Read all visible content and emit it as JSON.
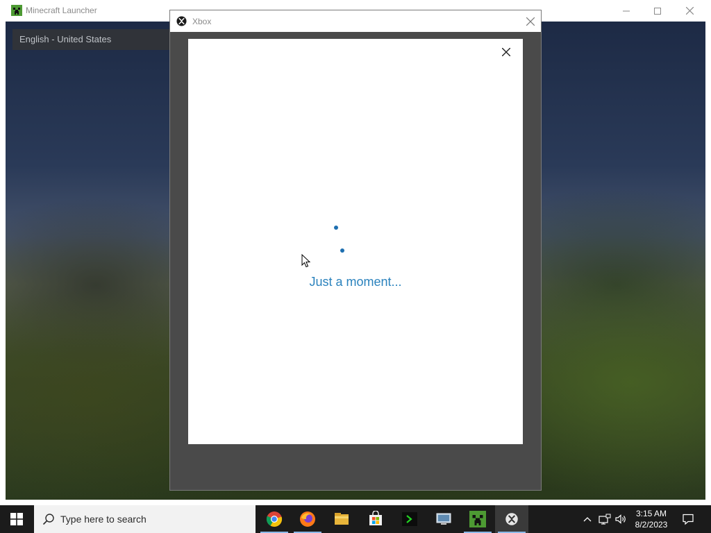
{
  "launcher": {
    "title": "Minecraft Launcher",
    "language": "English - United States"
  },
  "xbox_dialog": {
    "title": "Xbox",
    "loading_text": "Just a moment..."
  },
  "taskbar": {
    "search_placeholder": "Type here to search",
    "apps": [
      "chrome-icon",
      "firefox-icon",
      "file-explorer-icon",
      "microsoft-store-icon",
      "terminal-icon",
      "remote-desktop-icon",
      "minecraft-icon",
      "xbox-icon"
    ],
    "time": "3:15 AM",
    "date": "8/2/2023"
  },
  "colors": {
    "accent_blue": "#2a82bd",
    "spinner": "#1e6fb0",
    "taskbar": "#1b1b1b"
  }
}
